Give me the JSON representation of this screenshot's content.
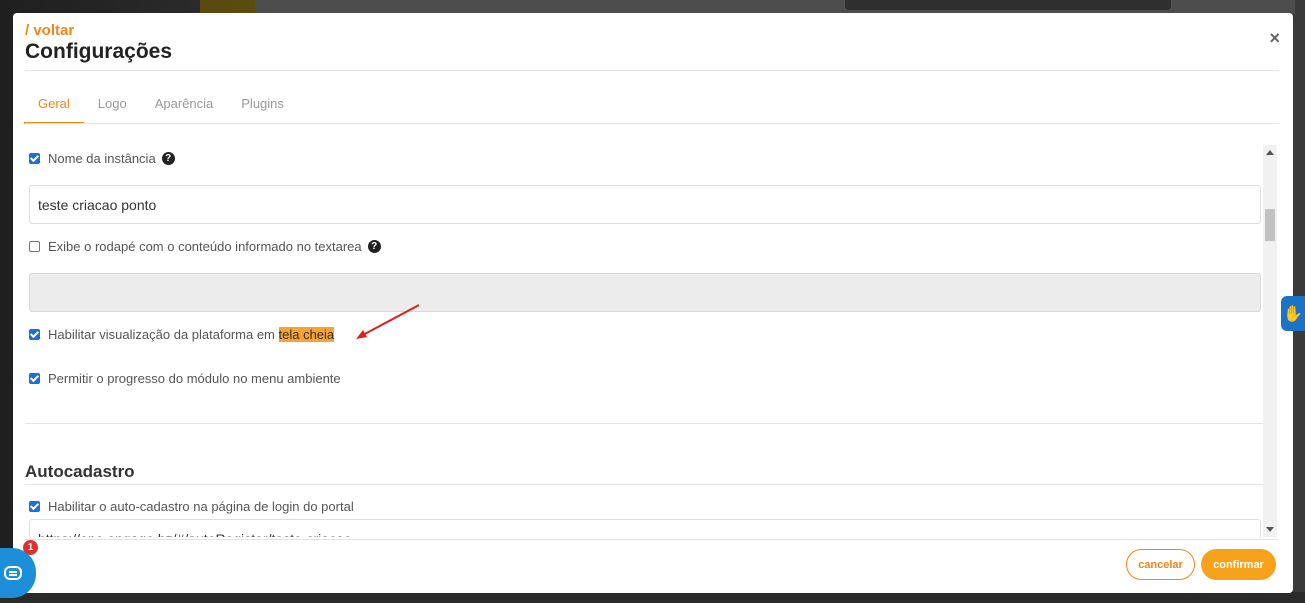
{
  "header": {
    "back_label": "/ voltar",
    "title": "Configurações",
    "close_label": "×"
  },
  "tabs": [
    {
      "label": "Geral",
      "active": true
    },
    {
      "label": "Logo",
      "active": false
    },
    {
      "label": "Aparência",
      "active": false
    },
    {
      "label": "Plugins",
      "active": false
    }
  ],
  "general": {
    "instance_name": {
      "label": "Nome da instância",
      "checked": true,
      "value": "teste criacao ponto",
      "help_icon": "question-circle-icon"
    },
    "footer": {
      "label": "Exibe o rodapé com o conteúdo informado no textarea",
      "checked": false,
      "value": "",
      "help_icon": "question-circle-icon"
    },
    "fullscreen": {
      "label_prefix": "Habilitar visualização da plataforma em ",
      "label_highlight": "tela cheia",
      "checked": true
    },
    "module_progress": {
      "label": "Permitir o progresso do módulo no menu ambiente",
      "checked": true
    }
  },
  "autocadastro": {
    "section_title": "Autocadastro",
    "enable": {
      "label": "Habilitar o auto-cadastro na página de login do portal",
      "checked": true
    },
    "url_value": "https://one.engage.bz/#/autoRegister/teste-criacao"
  },
  "footer_buttons": {
    "cancel_label": "cancelar",
    "confirm_label": "confirmar"
  },
  "chat_widget": {
    "badge_count": "1",
    "icon": "chat-bubble-icon"
  },
  "accessibility_widget": {
    "icon": "sign-language-hands-icon"
  },
  "colors": {
    "accent": "#f0861a",
    "confirm": "#f7a21b",
    "checkbox": "#1d6fd6",
    "highlight": "#f7a234",
    "annotation_arrow": "#e0201b"
  }
}
